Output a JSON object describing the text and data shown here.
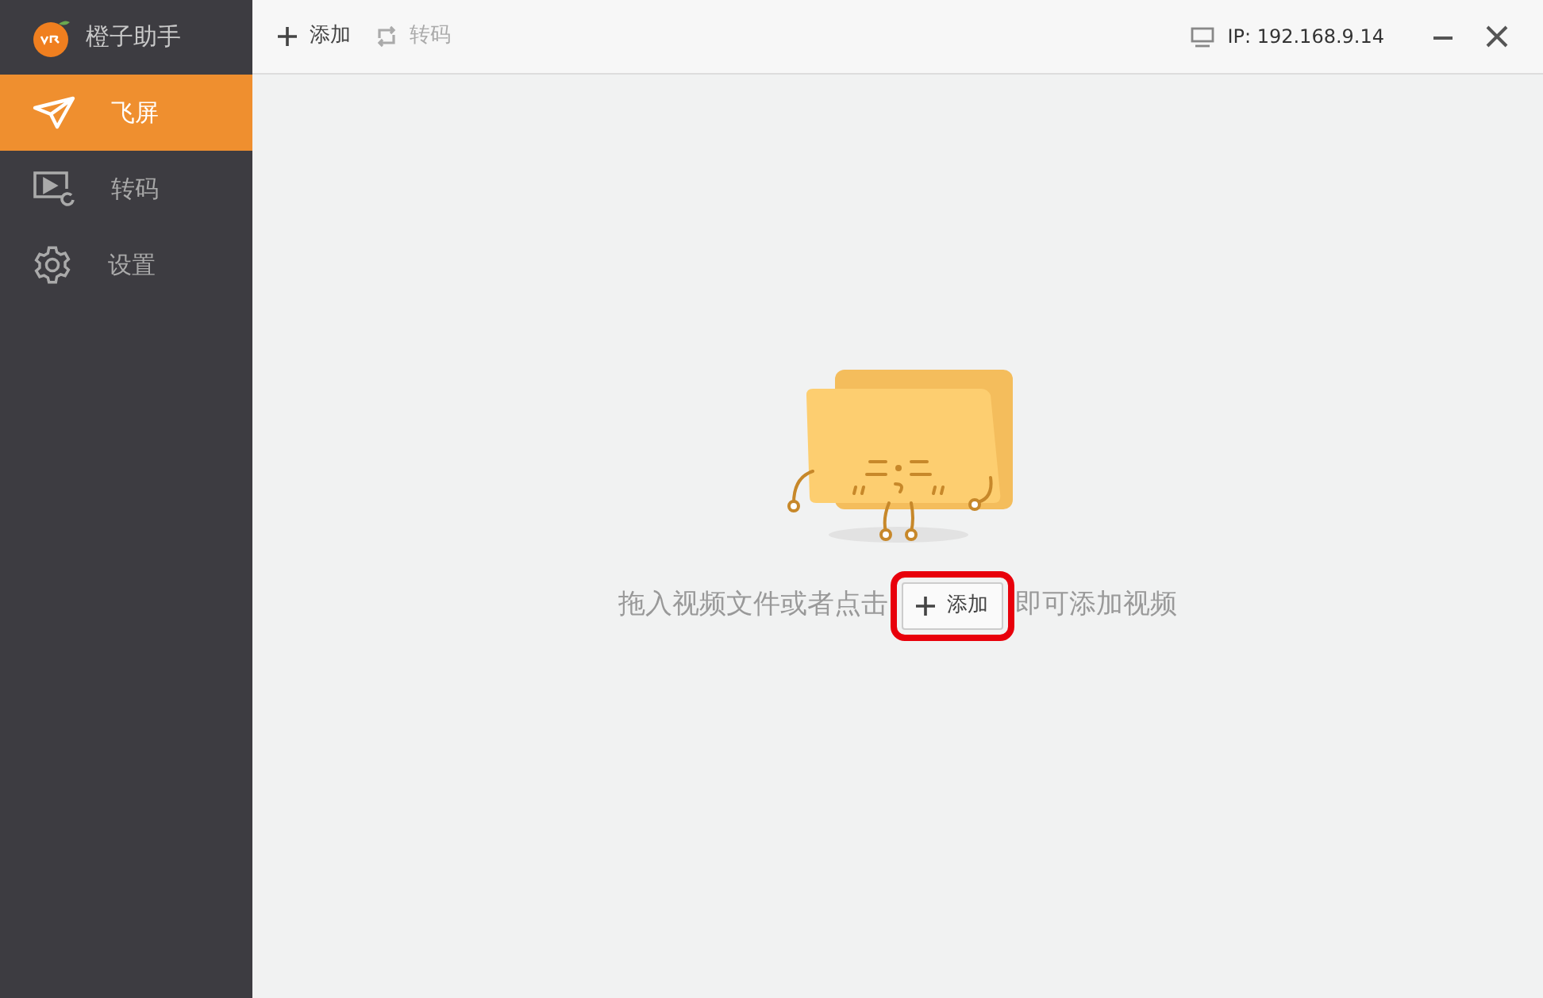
{
  "app": {
    "title": "橙子助手"
  },
  "sidebar": {
    "items": [
      {
        "kind": "plane",
        "label": "飞屏",
        "selected": true
      },
      {
        "kind": "video",
        "label": "转码",
        "selected": false
      },
      {
        "kind": "gear",
        "label": "设置",
        "selected": false
      }
    ]
  },
  "toolbar": {
    "buttons": [
      {
        "kind": "plus",
        "label": "添加",
        "disabled": false
      },
      {
        "kind": "convert",
        "label": "转码",
        "disabled": true
      }
    ],
    "ip": "IP: 192.168.9.14"
  },
  "empty_state": {
    "hint_before": "拖入视频文件或者点击",
    "button": "添加",
    "hint_after": "即可添加视频",
    "highlighted": true
  }
}
